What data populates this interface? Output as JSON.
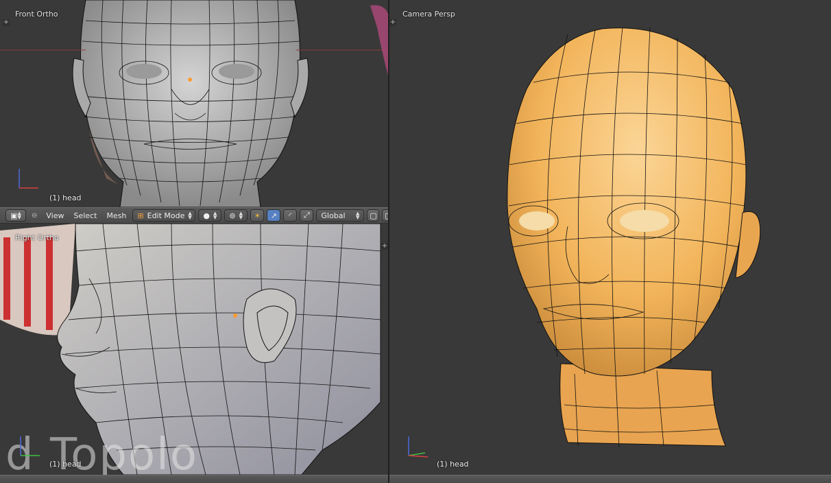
{
  "viewports": {
    "front": {
      "label": "Front Ortho",
      "object": "(1) head"
    },
    "right": {
      "label": "Right Ortho",
      "object": "(1) head"
    },
    "camera": {
      "label": "Camera Persp",
      "object": "(1) head"
    }
  },
  "header": {
    "view": "View",
    "select": "Select",
    "mesh": "Mesh",
    "mode": "Edit Mode",
    "orientation": "Global"
  },
  "watermark": "d Topolo",
  "axes": {
    "z": "z",
    "x": "x",
    "y": "y"
  },
  "colors": {
    "background": "#393939",
    "mesh_gray": "#b9b9b9",
    "mesh_orange": "#f2b45a",
    "wire": "#111111",
    "accent": "#5680c2",
    "origin": "#ff9a2e"
  },
  "icons": [
    "plus-icon",
    "cube-editor-icon",
    "mode-icon",
    "shading-sphere-icon",
    "pivot-icon",
    "manipulator-axis-icon",
    "translate-arrow-icon",
    "rotate-icon",
    "scale-icon",
    "layer-icon"
  ]
}
